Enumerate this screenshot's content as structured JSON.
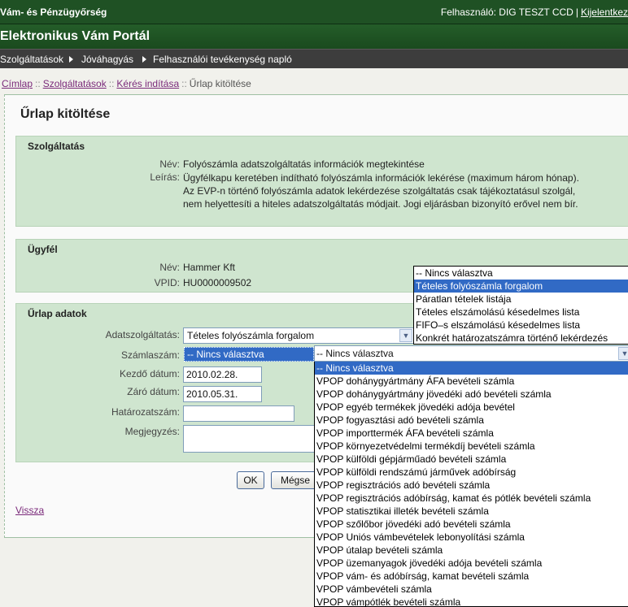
{
  "header": {
    "agency": "Vám- és Pénzügyőrség",
    "user_label": "Felhasználó: DIG TESZT CCD",
    "separator": "|",
    "logout": "Kijelentkez",
    "portal_title": "Elektronikus Vám Portál"
  },
  "nav": {
    "items": [
      "Szolgáltatások",
      "Jóváhagyás",
      "Felhasználói tevékenység napló"
    ]
  },
  "breadcrumb": {
    "items": [
      "Címlap",
      "Szolgáltatások",
      "Kérés indítása"
    ],
    "current": "Űrlap kitöltése",
    "separator": "::"
  },
  "page_title": "Űrlap kitöltése",
  "service_section": {
    "title": "Szolgáltatás",
    "name_label": "Név:",
    "name_value": "Folyószámla adatszolgáltatás információk megtekintése",
    "desc_label": "Leírás:",
    "desc_value": "Ügyfélkapu keretében indítható folyószámla információk lekérése (maximum három hónap). Az EVP-n történő folyószámla adatok lekérdezése szolgáltatás csak tájékoztatásul szolgál, nem helyettesíti a hiteles adatszolgáltatás módjait. Jogi eljárásban bizonyító erővel nem bír."
  },
  "client_section": {
    "title": "Ügyfél",
    "name_label": "Név:",
    "name_value": "Hammer Kft",
    "vpid_label": "VPID:",
    "vpid_value": "HU0000009502"
  },
  "form_section": {
    "title": "Űrlap adatok",
    "service_label": "Adatszolgáltatás:",
    "service_value": "Tételes folyószámla forgalom",
    "account_label": "Számlaszám:",
    "account_value": "-- Nincs választva",
    "start_label": "Kezdő dátum:",
    "start_value": "2010.02.28.",
    "end_label": "Záró dátum:",
    "end_value": "2010.05.31.",
    "resolution_label": "Határozatszám:",
    "resolution_value": "",
    "note_label": "Megjegyzés:",
    "ok_label": "OK",
    "cancel_label": "Mégse"
  },
  "back_link": "Vissza",
  "service_dropdown": {
    "options": [
      "-- Nincs választva",
      "Tételes folyószámla forgalom",
      "Páratlan tételek listája",
      "Tételes elszámolású késedelmes lista",
      "FIFO–s elszámolású késedelmes lista",
      "Konkrét határozatszámra történő lekérdezés"
    ],
    "selected_index": 1
  },
  "account_dropdown": {
    "header_value": "-- Nincs választva",
    "options": [
      "-- Nincs választva",
      "VPOP dohánygyártmány ÁFA bevételi számla",
      "VPOP dohánygyártmány jövedéki adó bevételi számla",
      "VPOP egyéb termékek jövedéki adója bevétel",
      "VPOP fogyasztási adó bevételi számla",
      "VPOP importtermék ÁFA bevételi számla",
      "VPOP környezetvédelmi termékdíj bevételi számla",
      "VPOP külföldi gépjárműadó bevételi számla",
      "VPOP külföldi rendszámú járművek adóbírság",
      "VPOP regisztrációs adó bevételi számla",
      "VPOP regisztrációs adóbírság, kamat és pótlék bevételi számla",
      "VPOP statisztikai illeték bevételi számla",
      "VPOP szőlőbor jövedéki adó bevételi számla",
      "VPOP Uniós vámbevételek lebonyolítási számla",
      "VPOP útalap bevételi számla",
      "VPOP üzemanyagok jövedéki adója bevételi számla",
      "VPOP vám- és adóbírság, kamat bevételi számla",
      "VPOP vámbevételi számla",
      "VPOP vámpótlék bevételi számla"
    ],
    "selected_index": 0
  }
}
